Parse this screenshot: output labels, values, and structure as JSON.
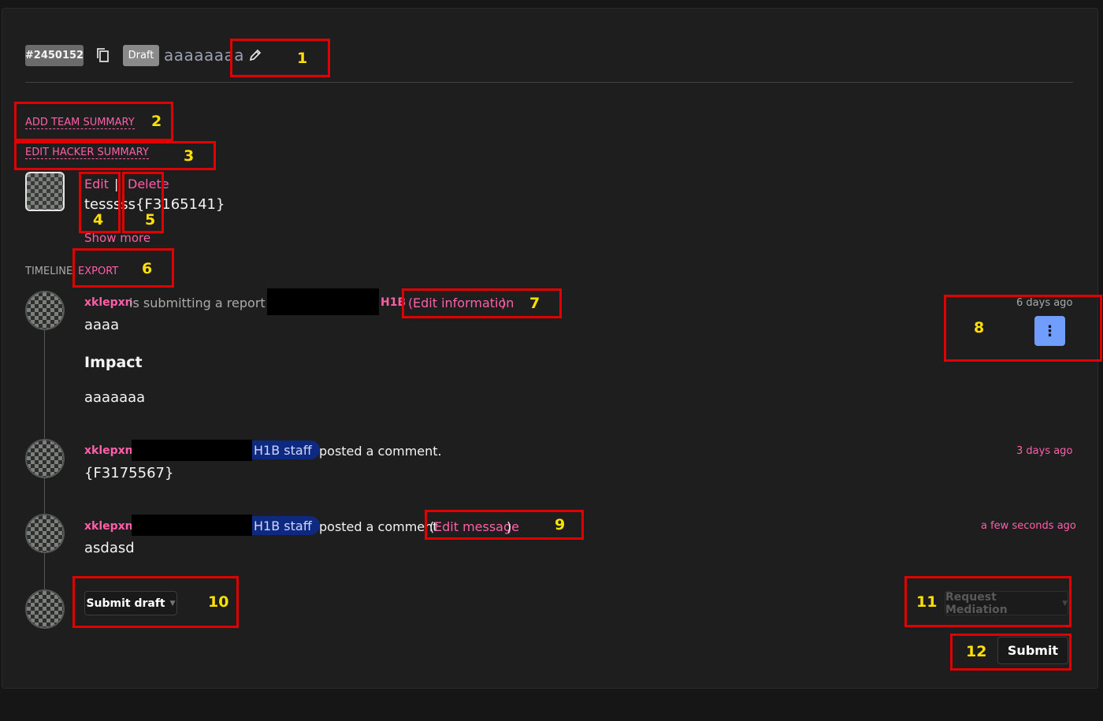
{
  "header": {
    "report_id": "#2450152",
    "status": "Draft",
    "title": "aaaaaaaa"
  },
  "summary_links": {
    "add_team_summary": "ADD TEAM SUMMARY",
    "edit_hacker_summary": "EDIT HACKER SUMMARY"
  },
  "hacker_summary": {
    "edit_label": "Edit",
    "separator": "|",
    "delete_label": "Delete",
    "content": "tesssss{F3165141}",
    "show_more": "Show more"
  },
  "timeline": {
    "label": "TIMELINE",
    "export_label": "EXPORT",
    "items": [
      {
        "user": "xklepxn",
        "action": "is submitting a report to",
        "program": "H1B",
        "edit_open": "(",
        "edit_link": "Edit information",
        "edit_close": ")",
        "time": "6 days ago",
        "body": "aaaa",
        "impact_heading": "Impact",
        "impact_body": "aaaaaaa"
      },
      {
        "user": "xklepxn",
        "badge": "H1B staff",
        "action": "posted a comment.",
        "time": "3 days ago",
        "body": "{F3175567}"
      },
      {
        "user": "xklepxn",
        "badge": "H1B staff",
        "action": "posted a comment",
        "edit_open": "(",
        "edit_link": "Edit message",
        "edit_close": ")",
        "time": "a few seconds ago",
        "body": "asdasd"
      }
    ]
  },
  "actions": {
    "submit_draft": "Submit draft",
    "request_mediation": "Request Mediation",
    "submit": "Submit"
  },
  "annotations": [
    "1",
    "2",
    "3",
    "4",
    "5",
    "6",
    "7",
    "8",
    "9",
    "10",
    "11",
    "12"
  ],
  "colors": {
    "accent_pink": "#ff5fa8",
    "annotation_red": "#e10000",
    "annotation_yellow": "#ffe000",
    "kebab_blue": "#6f9eff",
    "staff_badge": "#0d2a80"
  }
}
